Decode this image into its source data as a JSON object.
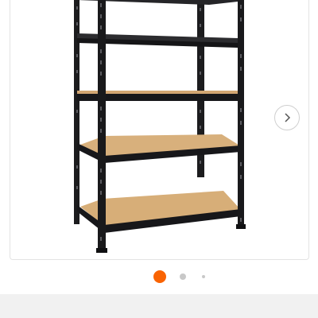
{
  "gallery": {
    "image_subject": "black-metal-5-tier-shelving-unit",
    "next_icon": "chevron-right-icon",
    "pagination": {
      "current_index": 1,
      "total_visible_dots": 3,
      "active_color": "#f96302",
      "inactive_color": "#c8c8c8"
    }
  },
  "colors": {
    "frame_metal": "#1c1c1e",
    "shelf_board": "#d6ad7a",
    "footer_background": "#f1f1f1"
  }
}
